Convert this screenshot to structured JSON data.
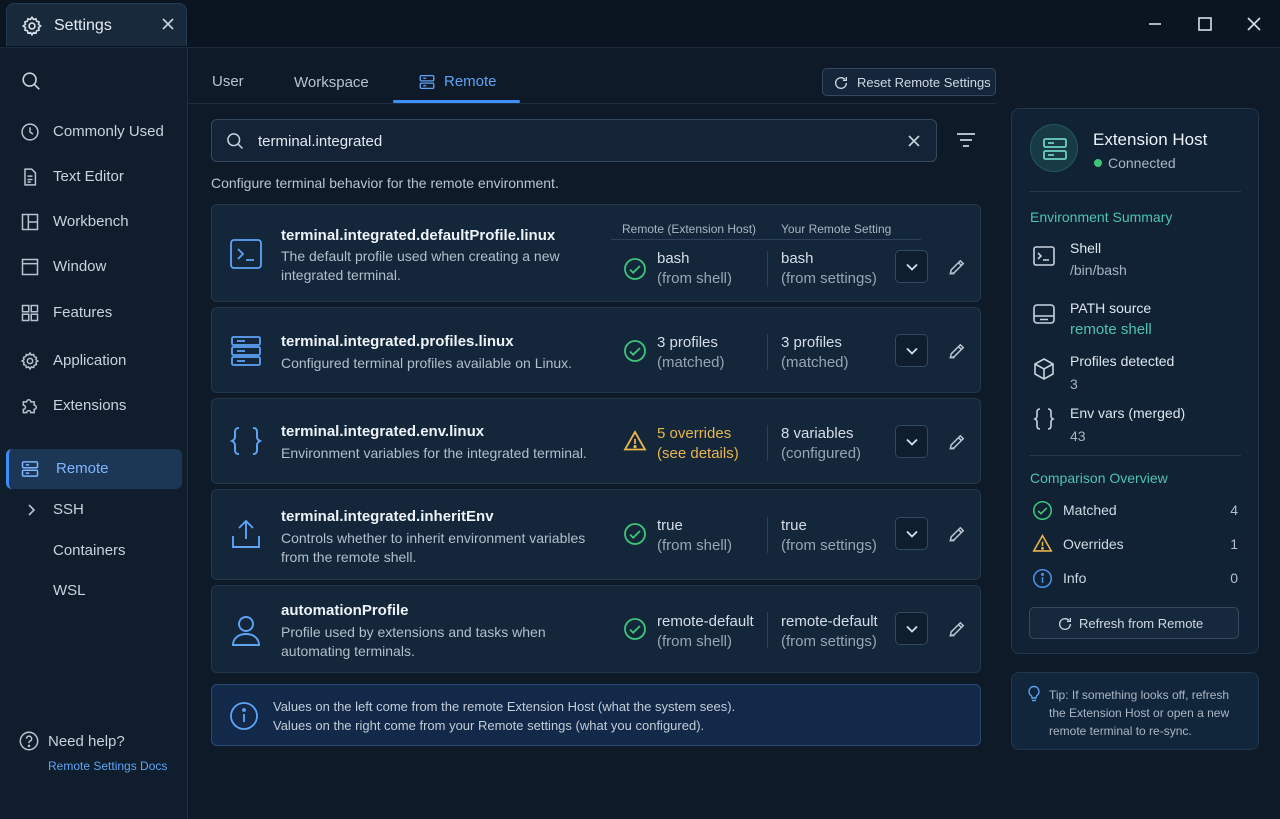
{
  "window": {
    "tab_title": "Settings"
  },
  "sidebar": {
    "items": [
      {
        "label": "Commonly Used",
        "icon": "clock-icon"
      },
      {
        "label": "Text Editor",
        "icon": "file-icon"
      },
      {
        "label": "Workbench",
        "icon": "layout-icon"
      },
      {
        "label": "Window",
        "icon": "window-icon"
      },
      {
        "label": "Features",
        "icon": "grid-icon"
      },
      {
        "label": "Application",
        "icon": "gear-icon"
      },
      {
        "label": "Extensions",
        "icon": "puzzle-icon"
      }
    ],
    "active": {
      "label": "Remote",
      "icon": "server-icon"
    },
    "subitems": [
      "SSH",
      "Containers",
      "WSL"
    ],
    "help": {
      "label": "Need help?",
      "link": "Remote Settings Docs"
    }
  },
  "tabs": {
    "user": "User",
    "workspace": "Workspace",
    "remote": "Remote",
    "active": "Remote"
  },
  "reset_button": "Reset Remote Settings",
  "search": {
    "value": "terminal.integrated"
  },
  "description": "Configure terminal behavior for the remote environment.",
  "columns": {
    "remote": "Remote (Extension Host)",
    "yours": "Your Remote Setting"
  },
  "settings": [
    {
      "title": "terminal.integrated.defaultProfile.linux",
      "desc": "The default profile used when creating a new integrated terminal.",
      "status": "ok",
      "remote_value": "bash",
      "remote_source": "(from shell)",
      "your_value": "bash",
      "your_source": "(from settings)"
    },
    {
      "title": "terminal.integrated.profiles.linux",
      "desc": "Configured terminal profiles available on Linux.",
      "status": "ok",
      "remote_value": "3 profiles",
      "remote_source": "(matched)",
      "your_value": "3 profiles",
      "your_source": "(matched)"
    },
    {
      "title": "terminal.integrated.env.linux",
      "desc": "Environment variables for the integrated terminal.",
      "status": "warning",
      "remote_value": "5 overrides",
      "remote_source": "(see details)",
      "your_value": "8 variables",
      "your_source": "(configured)"
    },
    {
      "title": "terminal.integrated.inheritEnv",
      "desc": "Controls whether to inherit environment variables from the remote shell.",
      "status": "ok",
      "remote_value": "true",
      "remote_source": "(from shell)",
      "your_value": "true",
      "your_source": "(from settings)"
    },
    {
      "title": "automationProfile",
      "desc": "Profile used by extensions and tasks when automating terminals.",
      "status": "ok",
      "remote_value": "remote-default",
      "remote_source": "(from shell)",
      "your_value": "remote-default",
      "your_source": "(from settings)"
    }
  ],
  "info_banner": {
    "line1": "Values on the left come from the remote Extension Host (what the system sees).",
    "line2": "Values on the right come from your Remote settings (what you configured)."
  },
  "extension_host": {
    "title": "Extension Host",
    "status": "Connected",
    "status_color": "#3fc57a"
  },
  "environment_summary": {
    "heading": "Environment Summary",
    "items": [
      {
        "label": "Shell",
        "value": "/bin/bash",
        "icon": "terminal-icon"
      },
      {
        "label": "PATH source",
        "value": "remote shell",
        "icon": "path-icon"
      },
      {
        "label": "Profiles detected",
        "value": "3",
        "icon": "cube-icon"
      },
      {
        "label": "Env vars (merged)",
        "value": "43",
        "icon": "braces-icon"
      }
    ]
  },
  "comparison": {
    "heading": "Comparison Overview",
    "items": [
      {
        "label": "Matched",
        "count": "4",
        "icon": "check-circle-icon",
        "color": "#3fc57a"
      },
      {
        "label": "Overrides",
        "count": "1",
        "icon": "warning-icon",
        "color": "#e9b54d"
      },
      {
        "label": "Info",
        "count": "0",
        "icon": "info-icon",
        "color": "#4a90e2"
      }
    ]
  },
  "refresh_button": "Refresh from Remote",
  "tip": "Tip: If something looks off, refresh the Extension Host or open a new remote terminal to re-sync.",
  "colors": {
    "accent": "#3e8ef7",
    "teal": "#4fc2b0",
    "ok": "#3fc57a",
    "warn": "#e9b54d"
  }
}
